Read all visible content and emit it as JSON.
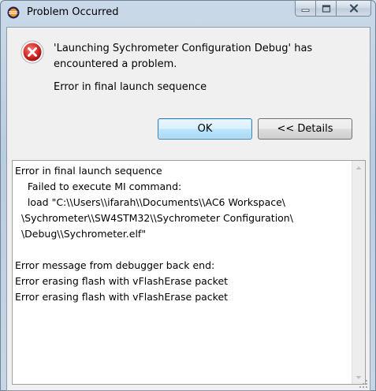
{
  "window": {
    "title": "Problem Occurred",
    "app_icon": "eclipse-icon",
    "caption_buttons": [
      "minimize-icon",
      "maximize-icon",
      "close-icon"
    ]
  },
  "dialog": {
    "icon": "error-icon",
    "message_line1": "'Launching Sychrometer Configuration Debug' has",
    "message_line2": "encountered a problem.",
    "error_text": "Error in final launch sequence",
    "ok_label": "OK",
    "details_label": "<< Details"
  },
  "details": {
    "lines": [
      "Error in final launch sequence",
      "    Failed to execute MI command:",
      "    load \"C:\\\\Users\\\\ifarah\\\\Documents\\\\AC6 Workspace\\",
      "  \\Sychrometer\\\\SW4STM32\\\\Sychrometer Configuration\\",
      "  \\Debug\\\\Sychrometer.elf\"",
      "",
      "Error message from debugger back end:",
      "Error erasing flash with vFlashErase packet",
      "Error erasing flash with vFlashErase packet"
    ]
  },
  "colors": {
    "error_red": "#d9302c",
    "default_button_border": "#3c7fb1"
  }
}
